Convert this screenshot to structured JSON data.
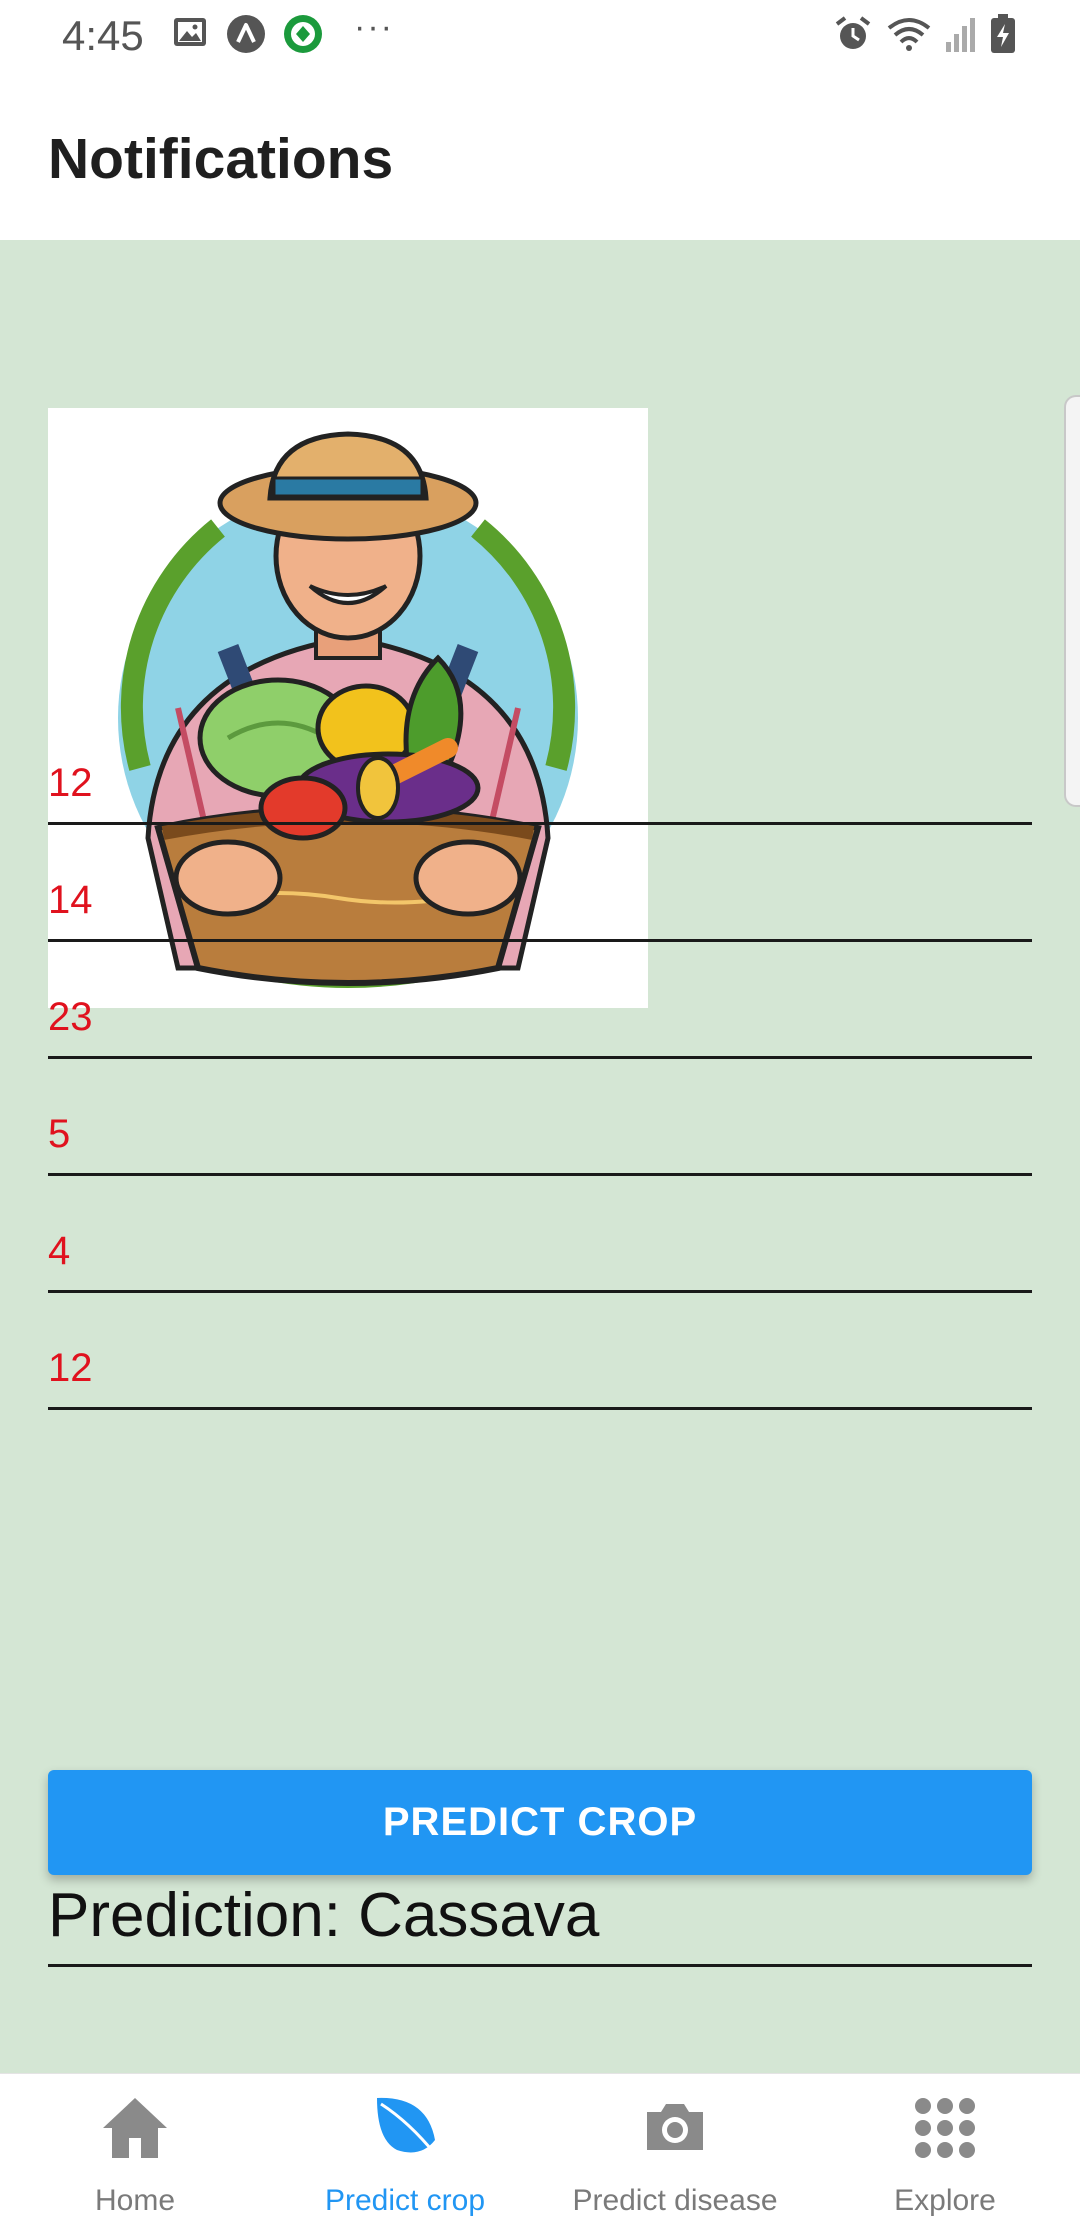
{
  "status_bar": {
    "time": "4:45"
  },
  "header": {
    "title": "Notifications"
  },
  "form": {
    "fields": [
      {
        "value": "12"
      },
      {
        "value": "14"
      },
      {
        "value": "23"
      },
      {
        "value": "5"
      },
      {
        "value": "4"
      },
      {
        "value": "12"
      }
    ],
    "predict_button": "PREDICT CROP",
    "prediction_text": "Prediction: Cassava"
  },
  "bottom_nav": {
    "items": [
      {
        "label": "Home",
        "icon": "home-icon"
      },
      {
        "label": "Predict crop",
        "icon": "leaf-icon",
        "active": true
      },
      {
        "label": "Predict disease",
        "icon": "camera-icon"
      },
      {
        "label": "Explore",
        "icon": "grid-icon"
      }
    ]
  },
  "colors": {
    "accent": "#2196f3",
    "content_bg": "#d4e6d4",
    "input_text": "#e0121e"
  }
}
